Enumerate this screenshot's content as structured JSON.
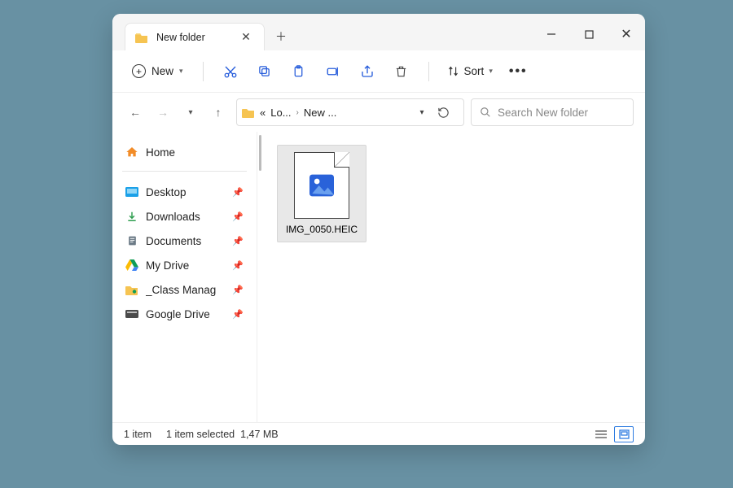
{
  "tab": {
    "title": "New folder"
  },
  "toolbar": {
    "new_label": "New",
    "sort_label": "Sort"
  },
  "breadcrumb": {
    "prefix": "«",
    "seg1": "Lo...",
    "seg2": "New ..."
  },
  "search": {
    "placeholder": "Search New folder"
  },
  "sidebar": {
    "home": "Home",
    "items": [
      {
        "label": "Desktop"
      },
      {
        "label": "Downloads"
      },
      {
        "label": "Documents"
      },
      {
        "label": "My Drive"
      },
      {
        "label": "_Class Manag"
      },
      {
        "label": "Google Drive"
      }
    ]
  },
  "file": {
    "name": "IMG_0050.HEIC"
  },
  "status": {
    "count": "1 item",
    "selected": "1 item selected",
    "size": "1,47 MB"
  }
}
